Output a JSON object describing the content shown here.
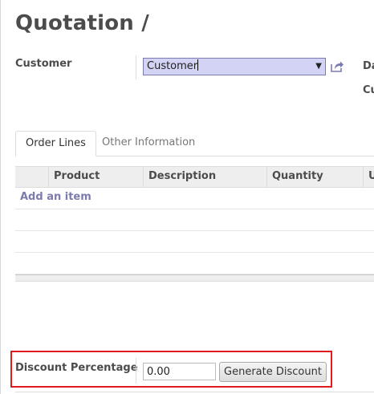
{
  "header": {
    "title": "Quotation /"
  },
  "customer": {
    "label": "Customer",
    "selected_value": "Customer"
  },
  "right_fields": {
    "date_label_partial": "Da",
    "second_label_partial": "Cu"
  },
  "tabs": [
    {
      "label": "Order Lines",
      "active": true
    },
    {
      "label": "Other Information",
      "active": false
    }
  ],
  "order_lines": {
    "columns": [
      "Product",
      "Description",
      "Quantity",
      "U"
    ],
    "add_item_label": "Add an item"
  },
  "discount": {
    "label": "Discount Percentage",
    "value": "0.00",
    "button_label": "Generate Discount"
  },
  "colors": {
    "accent": "#7c7bad",
    "select_bg": "#d3d3f5",
    "highlight_border": "#e01b1b"
  }
}
